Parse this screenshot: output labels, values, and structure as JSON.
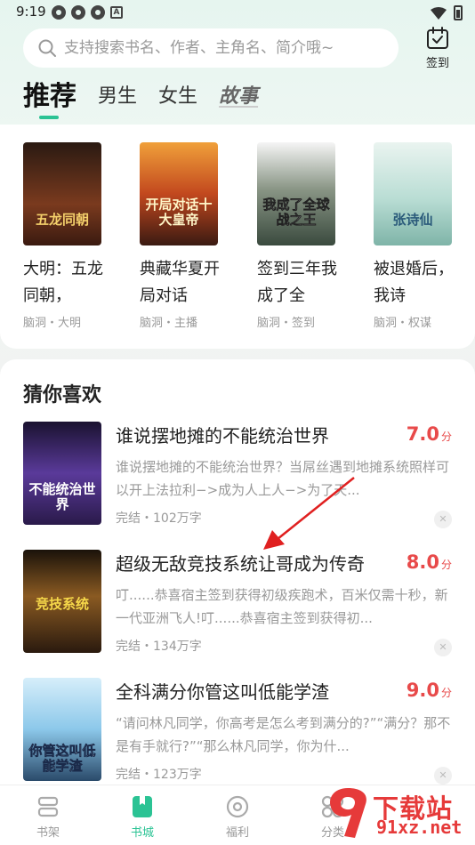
{
  "status_bar": {
    "time": "9:19"
  },
  "search": {
    "placeholder": "支持搜索书名、作者、主角名、简介哦~"
  },
  "checkin": {
    "label": "签到"
  },
  "tabs": [
    {
      "label": "推荐"
    },
    {
      "label": "男生"
    },
    {
      "label": "女生"
    },
    {
      "label": "故事"
    }
  ],
  "recommend": [
    {
      "title": "大明：五龙同朝，",
      "tags": "脑洞・大明",
      "cover_text": "五龙同朝",
      "cover_color": "#6b2a1a"
    },
    {
      "title": "典藏华夏开局对话",
      "tags": "脑洞・主播",
      "cover_text": "开局对话十大皇帝",
      "cover_color": "#b8401e"
    },
    {
      "title": "签到三年我成了全",
      "tags": "脑洞・签到",
      "cover_text": "我成了全球战之王",
      "cover_color": "#4d5a52"
    },
    {
      "title": "被退婚后，我诗",
      "tags": "脑洞・权谋",
      "cover_text": "张诗仙",
      "cover_color": "#9fc9c2"
    }
  ],
  "guess": {
    "title": "猜你喜欢",
    "items": [
      {
        "title": "谁说摆地摊的不能统治世界",
        "score": "7.0",
        "unit": "分",
        "desc": "谁说摆地摊的不能统治世界？当屌丝遇到地摊系统照样可以开上法拉利−>成为人上人−>为了天...",
        "meta": "完结・102万字",
        "cover_text": "不能统治世界",
        "cover_color": "#3a2a6b"
      },
      {
        "title": "超级无敌竞技系统让哥成为传奇",
        "score": "8.0",
        "unit": "分",
        "desc": "叮......恭喜宿主签到获得初级疾跑术，百米仅需十秒，新一代亚洲飞人!叮......恭喜宿主签到获得初...",
        "meta": "完结・134万字",
        "cover_text": "竞技系统",
        "cover_color": "#3a2412"
      },
      {
        "title": "全科满分你管这叫低能学渣",
        "score": "9.0",
        "unit": "分",
        "desc": "“请问林凡同学，你高考是怎么考到满分的?”“满分？那不是有手就行?”“那么林凡同学，你为什...",
        "meta": "完结・123万字",
        "cover_text": "你管这叫低能学渣",
        "cover_color": "#7cc3e8"
      }
    ]
  },
  "nav": [
    {
      "label": "书架",
      "icon": "bookshelf-icon"
    },
    {
      "label": "书城",
      "icon": "bookstore-icon"
    },
    {
      "label": "福利",
      "icon": "welfare-icon"
    },
    {
      "label": "分类",
      "icon": "category-icon"
    }
  ],
  "watermark": {
    "text": "下载站",
    "url": "91xz.net"
  },
  "colors": {
    "accent": "#2bc394",
    "score": "#e84a4a"
  }
}
